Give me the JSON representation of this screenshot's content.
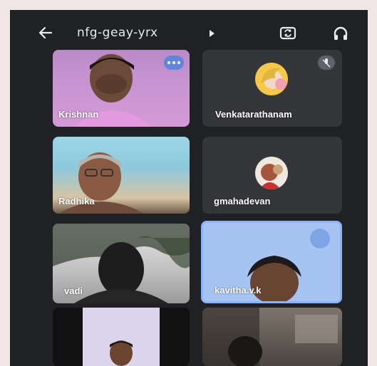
{
  "header": {
    "meeting_code": "nfg-geay-yrx",
    "back_icon": "arrow-left-icon",
    "switch_camera_icon": "switch-camera-icon",
    "audio_icon": "headphones-icon"
  },
  "participants": [
    {
      "name": "Krishnan"
    },
    {
      "name": "Venkatarathanam"
    },
    {
      "name": "Radhika"
    },
    {
      "name": "gmahadevan"
    },
    {
      "name": "vadi"
    },
    {
      "name": "kavitha.v.k"
    },
    {
      "name": ""
    },
    {
      "name": ""
    }
  ],
  "colors": {
    "background": "#202124",
    "tile": "#3c4043",
    "active_speaker": "#8ab4f8",
    "menu_badge": "#5f86d8"
  }
}
